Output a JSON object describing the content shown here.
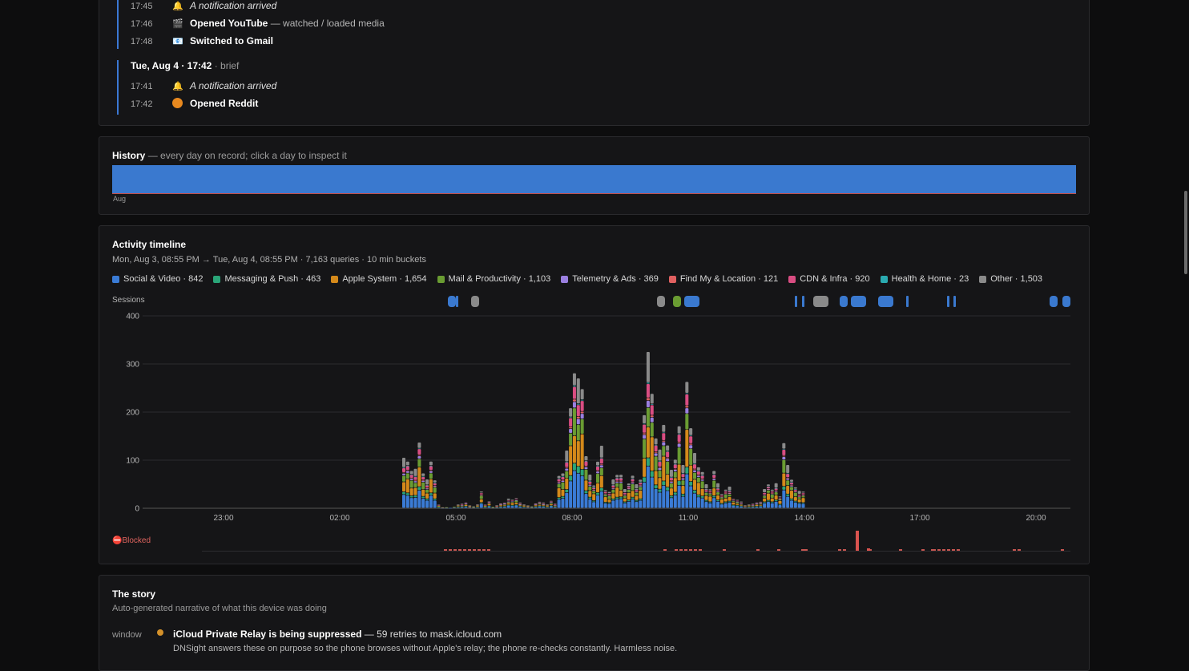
{
  "recent": {
    "session_a": {
      "rows": [
        {
          "time": "17:45",
          "icon": "🔔",
          "icon_name": "bell-icon",
          "title": "A notification arrived",
          "style": "italic",
          "suffix": ""
        },
        {
          "time": "17:46",
          "icon": "🎬",
          "icon_name": "youtube-icon",
          "title": "Opened YouTube",
          "style": "bold",
          "suffix": "— watched / loaded media"
        },
        {
          "time": "17:48",
          "icon": "📧",
          "icon_name": "mail-icon",
          "title": "Switched to Gmail",
          "style": "bold",
          "suffix": ""
        }
      ]
    },
    "session_b": {
      "header": "Tue, Aug 4 · 17:42",
      "header_tag": "· brief",
      "rows": [
        {
          "time": "17:41",
          "icon": "🔔",
          "icon_name": "bell-icon",
          "title": "A notification arrived",
          "style": "italic",
          "suffix": ""
        },
        {
          "time": "17:42",
          "icon": "",
          "icon_name": "reddit-icon",
          "title": "Opened Reddit",
          "style": "bold",
          "suffix": ""
        }
      ]
    }
  },
  "history": {
    "title": "History",
    "subtitle": "— every day on record; click a day to inspect it",
    "axis_label": "Aug"
  },
  "activity": {
    "title": "Activity timeline",
    "subtitle": "Mon, Aug 3, 08:55 PM → Tue, Aug 4, 08:55 PM · 7,163 queries · 10 min buckets",
    "sessions_label": "Sessions",
    "blocked_label": "⛔Blocked",
    "legend": [
      {
        "label": "Social & Video · 842",
        "color": "#3a7bd5"
      },
      {
        "label": "Messaging & Push · 463",
        "color": "#2aa578"
      },
      {
        "label": "Apple System · 1,654",
        "color": "#d4891a"
      },
      {
        "label": "Mail & Productivity · 1,103",
        "color": "#6a9c32"
      },
      {
        "label": "Telemetry & Ads · 369",
        "color": "#9a7fe0"
      },
      {
        "label": "Find My & Location · 121",
        "color": "#e06060"
      },
      {
        "label": "CDN & Infra · 920",
        "color": "#d94d82"
      },
      {
        "label": "Health & Home · 23",
        "color": "#2aaab0"
      },
      {
        "label": "Other · 1,503",
        "color": "#8a8a8a"
      }
    ]
  },
  "chart_data": {
    "type": "bar",
    "stacked": true,
    "ylim": [
      0,
      400
    ],
    "yticks": [
      0,
      100,
      200,
      300,
      400
    ],
    "xticks": [
      "23:00",
      "02:00",
      "05:00",
      "08:00",
      "11:00",
      "14:00",
      "17:00",
      "20:00"
    ],
    "bucket_minutes": 10,
    "totals": [
      105,
      98,
      80,
      82,
      138,
      75,
      60,
      98,
      60,
      8,
      3,
      3,
      2,
      4,
      8,
      10,
      12,
      6,
      4,
      8,
      36,
      8,
      15,
      4,
      6,
      10,
      12,
      20,
      18,
      22,
      12,
      8,
      6,
      4,
      10,
      14,
      12,
      8,
      16,
      10,
      68,
      75,
      120,
      210,
      290,
      270,
      250,
      112,
      70,
      48,
      100,
      130,
      38,
      35,
      60,
      70,
      72,
      40,
      52,
      70,
      50,
      60,
      200,
      325,
      240,
      150,
      122,
      175,
      135,
      80,
      102,
      176,
      90,
      265,
      172,
      115,
      86,
      78,
      50,
      40,
      80,
      52,
      30,
      40,
      45,
      20,
      18,
      14,
      6,
      8,
      10,
      12,
      14,
      40,
      50,
      40,
      52,
      25,
      140,
      90,
      60,
      45,
      36,
      35
    ],
    "sessions": [
      {
        "type": "short",
        "color": "#3a79cf"
      },
      {
        "type": "tick",
        "color": "#3a79cf"
      },
      {
        "type": "short",
        "color": "#8a8a8a"
      },
      {
        "type": "short",
        "color": "#8a8a8a"
      },
      {
        "type": "short",
        "color": "#6a9c32"
      },
      {
        "type": "long",
        "color": "#3a79cf"
      },
      {
        "type": "tick",
        "color": "#3a79cf"
      },
      {
        "type": "tick",
        "color": "#3a79cf"
      },
      {
        "type": "long",
        "color": "#8a8a8a"
      },
      {
        "type": "short",
        "color": "#3a79cf"
      },
      {
        "type": "long",
        "color": "#3a79cf"
      },
      {
        "type": "long",
        "color": "#3a79cf"
      },
      {
        "type": "tick",
        "color": "#3a79cf"
      },
      {
        "type": "tick",
        "color": "#3a79cf"
      },
      {
        "type": "tick",
        "color": "#3a79cf"
      },
      {
        "type": "short",
        "color": "#3a79cf"
      },
      {
        "type": "short",
        "color": "#3a79cf"
      }
    ]
  },
  "story": {
    "title": "The story",
    "subtitle": "Auto-generated narrative of what this device was doing",
    "row_label": "window",
    "headline": "iCloud Private Relay is being suppressed",
    "headline_suffix": "— 59 retries to mask.icloud.com",
    "description": "DNSight answers these on purpose so the phone browses without Apple's relay; the phone re-checks constantly. Harmless noise."
  }
}
